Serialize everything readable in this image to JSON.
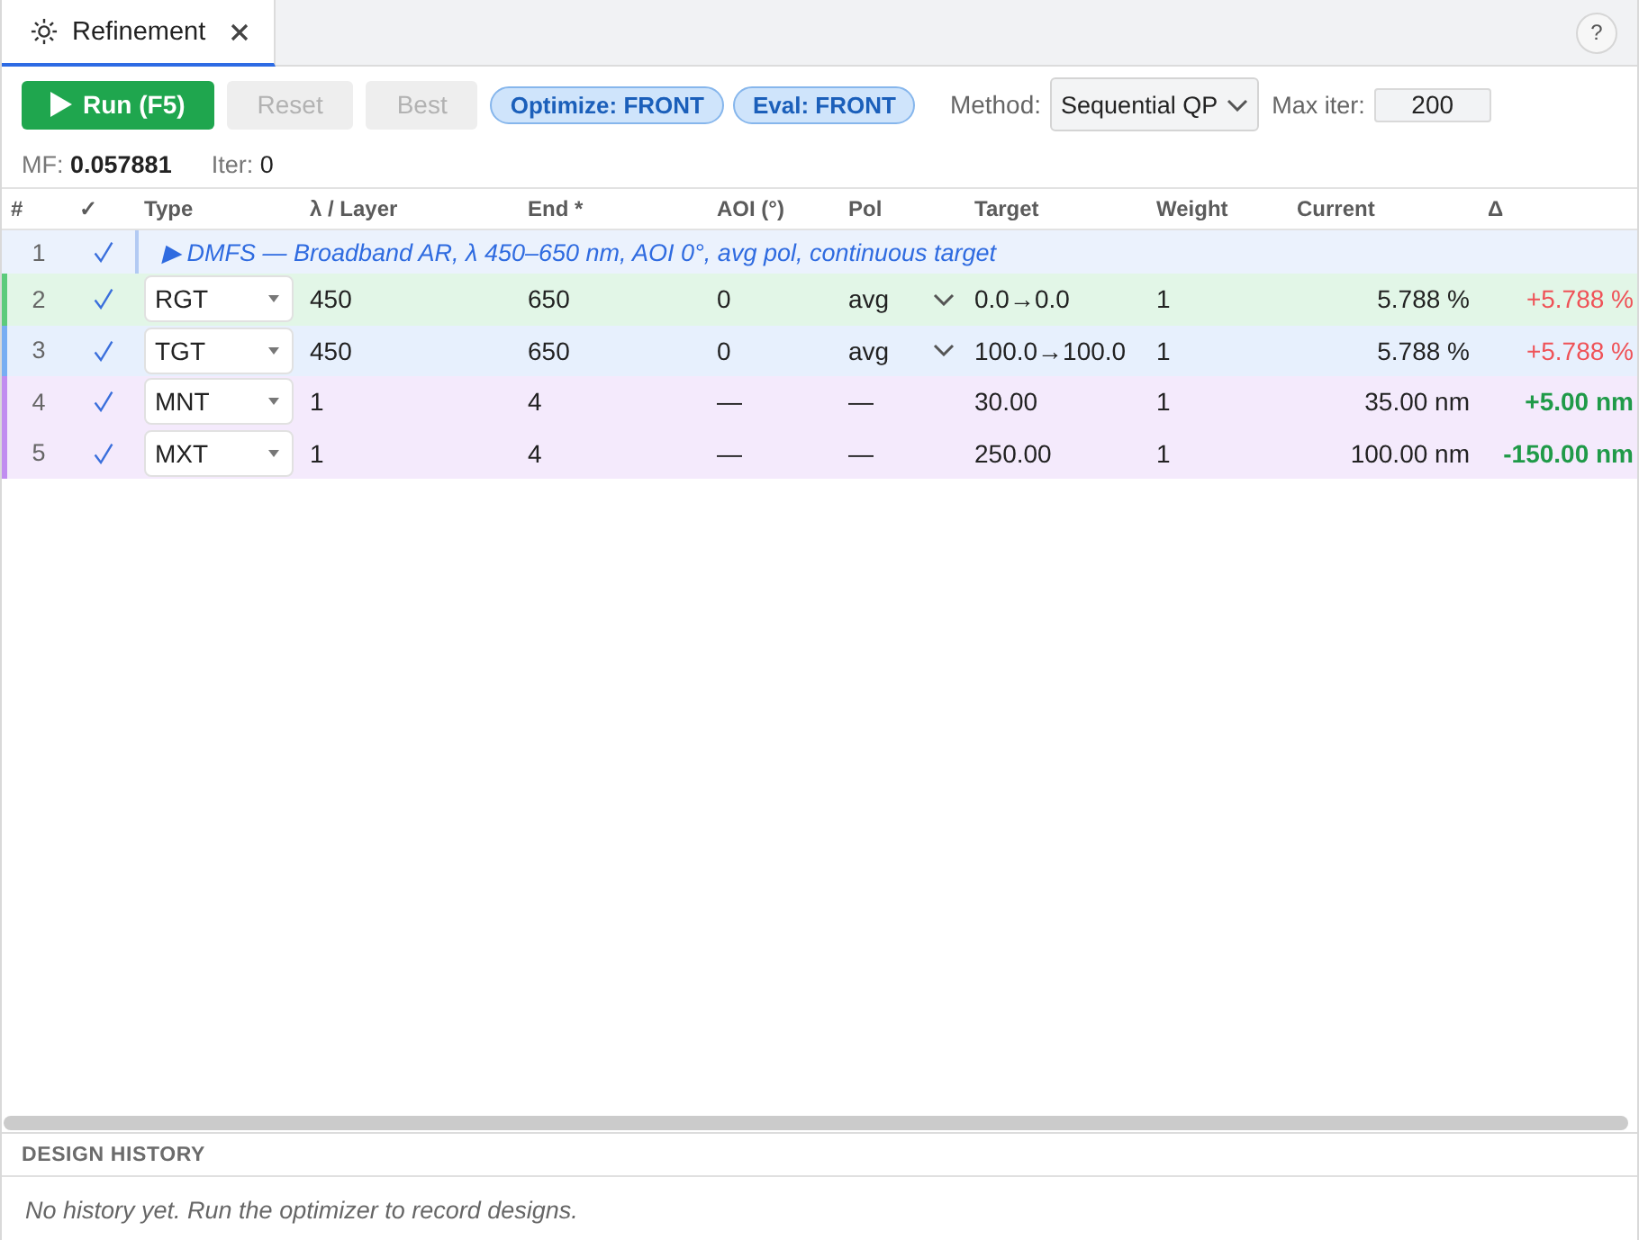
{
  "tabs": [
    {
      "label": "Refinement",
      "selected": true,
      "closable": true
    }
  ],
  "help_button": {
    "label": "?"
  },
  "toolbar": {
    "buttons": [
      {
        "label": "Run (F5)",
        "kind": "primary",
        "disabled": false
      },
      {
        "label": "Reset",
        "kind": "secondary",
        "disabled": true
      },
      {
        "label": "Best",
        "kind": "secondary",
        "disabled": true
      }
    ],
    "badges": [
      {
        "label": "Optimize: FRONT"
      },
      {
        "label": "Eval: FRONT"
      }
    ],
    "method": {
      "label": "Method:",
      "value": "Sequential QP"
    },
    "max_iter": {
      "label": "Max iter:",
      "value": "200"
    }
  },
  "stats": [
    {
      "label": "MF:",
      "value": "0.057881",
      "emphasized": true
    },
    {
      "label": "Iter:",
      "value": "0",
      "emphasized": false
    }
  ],
  "table": {
    "columns": [
      "#",
      "✓",
      "Type",
      "λ / Layer",
      "End *",
      "AOI (°)",
      "Pol",
      "Target",
      "Weight",
      "Current",
      "Δ"
    ],
    "rows": [
      {
        "kind": "group",
        "number": "1",
        "checked": true,
        "text": "▶ DMFS — Broadband AR, λ 450–650 nm, AOI 0°, avg pol, continuous target"
      },
      {
        "kind": "target",
        "number": "2",
        "checked": true,
        "color": "#5ccb7c",
        "type": "RGT",
        "start": "450",
        "end": "650",
        "aoi": "0",
        "pol": "avg",
        "pol_dropdown": true,
        "target": "0.0→0.0",
        "weight": "1",
        "current": "5.788 %",
        "delta": "+5.788 %",
        "delta_ok": false
      },
      {
        "kind": "target",
        "number": "3",
        "checked": true,
        "color": "#78aef3",
        "type": "TGT",
        "start": "450",
        "end": "650",
        "aoi": "0",
        "pol": "avg",
        "pol_dropdown": true,
        "target": "100.0→100.0",
        "weight": "1",
        "current": "5.788 %",
        "delta": "+5.788 %",
        "delta_ok": false
      },
      {
        "kind": "target",
        "number": "4",
        "checked": true,
        "color": "#c18df0",
        "type": "MNT",
        "start": "1",
        "end": "4",
        "aoi": "—",
        "pol": "—",
        "pol_dropdown": false,
        "target": "30.00",
        "weight": "1",
        "current": "35.00 nm",
        "delta": "+5.00 nm",
        "delta_ok": true
      },
      {
        "kind": "target",
        "number": "5",
        "checked": true,
        "color": "#c18df0",
        "type": "MXT",
        "start": "1",
        "end": "4",
        "aoi": "—",
        "pol": "—",
        "pol_dropdown": false,
        "target": "250.00",
        "weight": "1",
        "current": "100.00 nm",
        "delta": "-150.00 nm",
        "delta_ok": true
      }
    ]
  },
  "history": {
    "title": "DESIGN HISTORY",
    "empty_text": "No history yet. Run the optimizer to record designs."
  }
}
